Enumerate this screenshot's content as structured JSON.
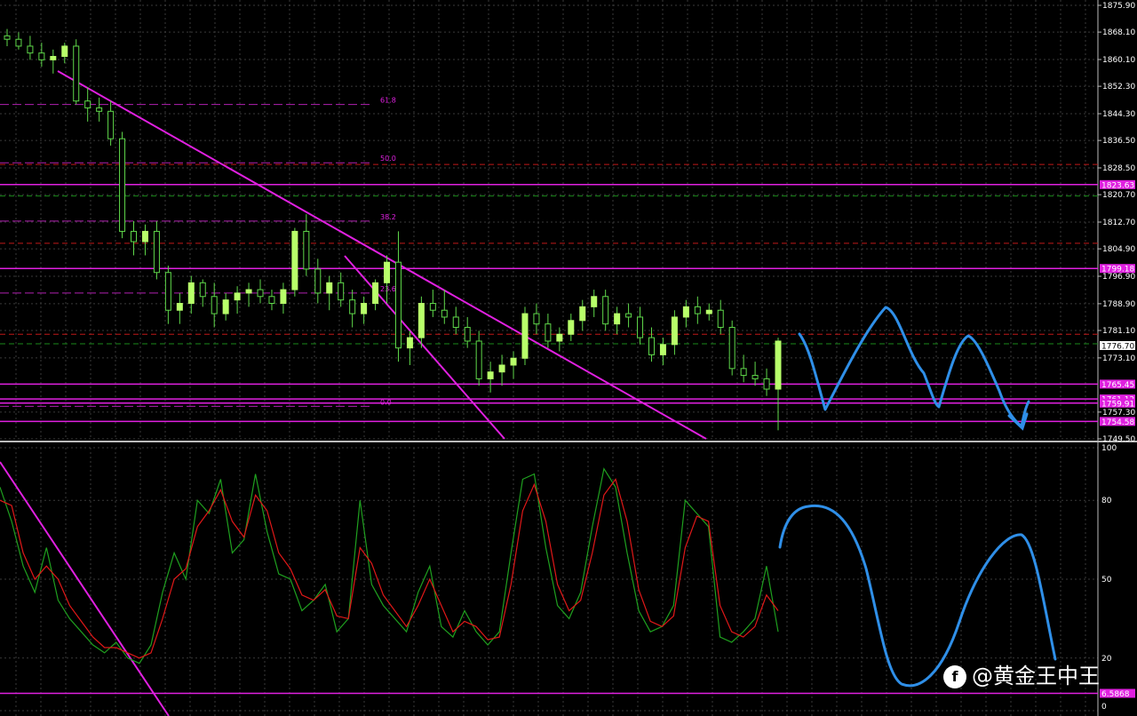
{
  "chart_data": [
    {
      "type": "candlestick",
      "y_range": [
        1749.5,
        1875.9
      ],
      "price_ticks": [
        "1875.90",
        "1868.10",
        "1860.10",
        "1852.30",
        "1844.30",
        "1836.50",
        "1828.50",
        "1820.70",
        "1812.70",
        "1804.90",
        "1796.90",
        "1788.90",
        "1781.10",
        "1773.10",
        "1757.30",
        "1749.50"
      ],
      "current_price": "1776.70",
      "level_tags": [
        {
          "label": "1823.63",
          "price": 1823.63,
          "color": "#e020e0"
        },
        {
          "label": "1799.18",
          "price": 1799.18,
          "color": "#e020e0"
        },
        {
          "label": "1765.45",
          "price": 1765.45,
          "color": "#e020e0"
        },
        {
          "label": "1761.12",
          "price": 1761.12,
          "color": "#e020e0"
        },
        {
          "label": "1759.91",
          "price": 1759.91,
          "color": "#e020e0"
        },
        {
          "label": "1754.58",
          "price": 1754.58,
          "color": "#e020e0"
        }
      ],
      "fibonacci": [
        {
          "label": "61.8",
          "price": 1847.0
        },
        {
          "label": "50.0",
          "price": 1830.0
        },
        {
          "label": "38.2",
          "price": 1813.0
        },
        {
          "label": "23.6",
          "price": 1792.0
        },
        {
          "label": "0.0",
          "price": 1759.0
        }
      ],
      "red_dashed_levels": [
        1829.5,
        1806.5,
        1780.0
      ],
      "green_dashed_levels": [
        1820.3,
        1777.2
      ],
      "candles": [
        {
          "o": 1867,
          "h": 1869,
          "l": 1864,
          "c": 1866
        },
        {
          "o": 1866,
          "h": 1868,
          "l": 1863,
          "c": 1864
        },
        {
          "o": 1864,
          "h": 1867,
          "l": 1860,
          "c": 1862
        },
        {
          "o": 1862,
          "h": 1865,
          "l": 1858,
          "c": 1860
        },
        {
          "o": 1860,
          "h": 1863,
          "l": 1856,
          "c": 1861
        },
        {
          "o": 1861,
          "h": 1865,
          "l": 1859,
          "c": 1864
        },
        {
          "o": 1864,
          "h": 1866,
          "l": 1847,
          "c": 1848
        },
        {
          "o": 1848,
          "h": 1852,
          "l": 1842,
          "c": 1846
        },
        {
          "o": 1846,
          "h": 1849,
          "l": 1842,
          "c": 1845
        },
        {
          "o": 1845,
          "h": 1848,
          "l": 1835,
          "c": 1837
        },
        {
          "o": 1837,
          "h": 1839,
          "l": 1808,
          "c": 1810
        },
        {
          "o": 1810,
          "h": 1813,
          "l": 1803,
          "c": 1807
        },
        {
          "o": 1807,
          "h": 1812,
          "l": 1803,
          "c": 1810
        },
        {
          "o": 1810,
          "h": 1813,
          "l": 1796,
          "c": 1798
        },
        {
          "o": 1798,
          "h": 1800,
          "l": 1783,
          "c": 1787
        },
        {
          "o": 1787,
          "h": 1792,
          "l": 1783,
          "c": 1789
        },
        {
          "o": 1789,
          "h": 1797,
          "l": 1786,
          "c": 1795
        },
        {
          "o": 1795,
          "h": 1796,
          "l": 1788,
          "c": 1791
        },
        {
          "o": 1791,
          "h": 1795,
          "l": 1782,
          "c": 1786
        },
        {
          "o": 1786,
          "h": 1792,
          "l": 1784,
          "c": 1790
        },
        {
          "o": 1790,
          "h": 1794,
          "l": 1786,
          "c": 1792
        },
        {
          "o": 1792,
          "h": 1795,
          "l": 1788,
          "c": 1793
        },
        {
          "o": 1793,
          "h": 1796,
          "l": 1789,
          "c": 1791
        },
        {
          "o": 1791,
          "h": 1793,
          "l": 1787,
          "c": 1789
        },
        {
          "o": 1789,
          "h": 1795,
          "l": 1786,
          "c": 1793
        },
        {
          "o": 1793,
          "h": 1811,
          "l": 1791,
          "c": 1810
        },
        {
          "o": 1810,
          "h": 1815,
          "l": 1797,
          "c": 1799
        },
        {
          "o": 1799,
          "h": 1802,
          "l": 1789,
          "c": 1792
        },
        {
          "o": 1792,
          "h": 1797,
          "l": 1787,
          "c": 1795
        },
        {
          "o": 1795,
          "h": 1798,
          "l": 1788,
          "c": 1790
        },
        {
          "o": 1790,
          "h": 1793,
          "l": 1782,
          "c": 1786
        },
        {
          "o": 1786,
          "h": 1791,
          "l": 1783,
          "c": 1789
        },
        {
          "o": 1789,
          "h": 1796,
          "l": 1787,
          "c": 1795
        },
        {
          "o": 1795,
          "h": 1803,
          "l": 1789,
          "c": 1801
        },
        {
          "o": 1801,
          "h": 1810,
          "l": 1772,
          "c": 1776
        },
        {
          "o": 1776,
          "h": 1781,
          "l": 1771,
          "c": 1779
        },
        {
          "o": 1779,
          "h": 1791,
          "l": 1776,
          "c": 1789
        },
        {
          "o": 1789,
          "h": 1793,
          "l": 1785,
          "c": 1787
        },
        {
          "o": 1787,
          "h": 1793,
          "l": 1783,
          "c": 1785
        },
        {
          "o": 1785,
          "h": 1788,
          "l": 1780,
          "c": 1782
        },
        {
          "o": 1782,
          "h": 1785,
          "l": 1776,
          "c": 1778
        },
        {
          "o": 1778,
          "h": 1781,
          "l": 1765,
          "c": 1767
        },
        {
          "o": 1767,
          "h": 1772,
          "l": 1763,
          "c": 1769
        },
        {
          "o": 1769,
          "h": 1774,
          "l": 1765,
          "c": 1771
        },
        {
          "o": 1771,
          "h": 1775,
          "l": 1767,
          "c": 1773
        },
        {
          "o": 1773,
          "h": 1788,
          "l": 1771,
          "c": 1786
        },
        {
          "o": 1786,
          "h": 1789,
          "l": 1780,
          "c": 1783
        },
        {
          "o": 1783,
          "h": 1786,
          "l": 1776,
          "c": 1778
        },
        {
          "o": 1778,
          "h": 1782,
          "l": 1775,
          "c": 1780
        },
        {
          "o": 1780,
          "h": 1786,
          "l": 1778,
          "c": 1784
        },
        {
          "o": 1784,
          "h": 1790,
          "l": 1781,
          "c": 1788
        },
        {
          "o": 1788,
          "h": 1793,
          "l": 1785,
          "c": 1791
        },
        {
          "o": 1791,
          "h": 1793,
          "l": 1781,
          "c": 1783
        },
        {
          "o": 1783,
          "h": 1788,
          "l": 1780,
          "c": 1786
        },
        {
          "o": 1786,
          "h": 1789,
          "l": 1782,
          "c": 1785
        },
        {
          "o": 1785,
          "h": 1788,
          "l": 1777,
          "c": 1779
        },
        {
          "o": 1779,
          "h": 1782,
          "l": 1772,
          "c": 1774
        },
        {
          "o": 1774,
          "h": 1779,
          "l": 1771,
          "c": 1777
        },
        {
          "o": 1777,
          "h": 1787,
          "l": 1774,
          "c": 1785
        },
        {
          "o": 1785,
          "h": 1790,
          "l": 1782,
          "c": 1788
        },
        {
          "o": 1788,
          "h": 1791,
          "l": 1783,
          "c": 1786
        },
        {
          "o": 1786,
          "h": 1789,
          "l": 1784,
          "c": 1787
        },
        {
          "o": 1787,
          "h": 1790,
          "l": 1780,
          "c": 1782
        },
        {
          "o": 1782,
          "h": 1784,
          "l": 1768,
          "c": 1770
        },
        {
          "o": 1770,
          "h": 1774,
          "l": 1766,
          "c": 1768
        },
        {
          "o": 1768,
          "h": 1772,
          "l": 1765,
          "c": 1767
        },
        {
          "o": 1767,
          "h": 1770,
          "l": 1762,
          "c": 1764
        },
        {
          "o": 1764,
          "h": 1779,
          "l": 1752,
          "c": 1778
        }
      ]
    },
    {
      "type": "line",
      "y_range": [
        0,
        100
      ],
      "y_ticks": [
        "100",
        "80",
        "50",
        "20",
        "0"
      ],
      "level_tag": "6.5868",
      "series": [
        {
          "color": "#1fa01f",
          "values": [
            85,
            72,
            55,
            45,
            62,
            42,
            35,
            30,
            25,
            22,
            26,
            20,
            18,
            25,
            45,
            60,
            50,
            80,
            75,
            88,
            60,
            65,
            90,
            68,
            52,
            50,
            38,
            42,
            48,
            30,
            35,
            80,
            48,
            40,
            35,
            30,
            45,
            55,
            32,
            28,
            38,
            30,
            25,
            30,
            60,
            88,
            90,
            62,
            40,
            35,
            45,
            70,
            92,
            85,
            60,
            38,
            30,
            32,
            40,
            80,
            75,
            70,
            28,
            26,
            30,
            35,
            55,
            30
          ]
        },
        {
          "color": "#e01818",
          "values": [
            80,
            78,
            60,
            50,
            55,
            50,
            40,
            34,
            28,
            24,
            24,
            22,
            20,
            22,
            35,
            50,
            54,
            70,
            76,
            84,
            72,
            66,
            82,
            76,
            60,
            54,
            44,
            42,
            46,
            36,
            35,
            62,
            56,
            44,
            38,
            32,
            40,
            50,
            40,
            30,
            34,
            32,
            27,
            28,
            48,
            76,
            86,
            72,
            48,
            38,
            42,
            60,
            82,
            88,
            72,
            46,
            34,
            32,
            36,
            62,
            74,
            72,
            40,
            30,
            28,
            32,
            44,
            38
          ]
        }
      ]
    }
  ],
  "watermark": {
    "logo": "f",
    "text": "@黄金王中王"
  }
}
